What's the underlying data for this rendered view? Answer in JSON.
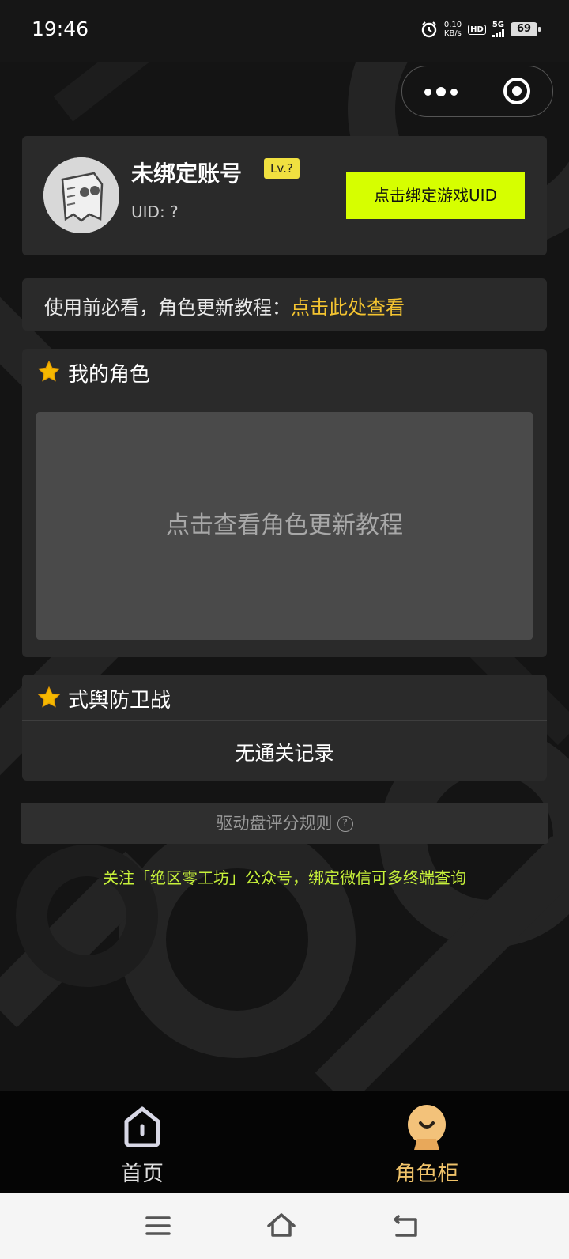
{
  "status_bar": {
    "time": "19:46",
    "speed_value": "0.10",
    "speed_unit": "KB/s",
    "hd": "HD",
    "network": "5G",
    "battery": "69"
  },
  "profile": {
    "name": "未绑定账号",
    "level": "Lv.?",
    "uid": "UID: ?",
    "bind_button": "点击绑定游戏UID"
  },
  "notice": {
    "text": "使用前必看，角色更新教程：",
    "link": "点击此处查看"
  },
  "my_roles": {
    "title": "我的角色",
    "placeholder": "点击查看角色更新教程"
  },
  "defense": {
    "title": "式舆防卫战",
    "empty": "无通关记录"
  },
  "rules": {
    "label": "驱动盘评分规则",
    "help": "?"
  },
  "follow_text": "关注「绝区零工坊」公众号，绑定微信可多终端查询",
  "tabs": [
    {
      "label": "首页",
      "icon": "home-icon",
      "active": false
    },
    {
      "label": "角色柜",
      "icon": "character-icon",
      "active": true
    }
  ],
  "colors": {
    "accent_button": "#d6ff00",
    "link": "#f4c430",
    "follow_text": "#c7f23a",
    "tab_active": "#f0c36a",
    "level_badge": "#f0e040"
  }
}
